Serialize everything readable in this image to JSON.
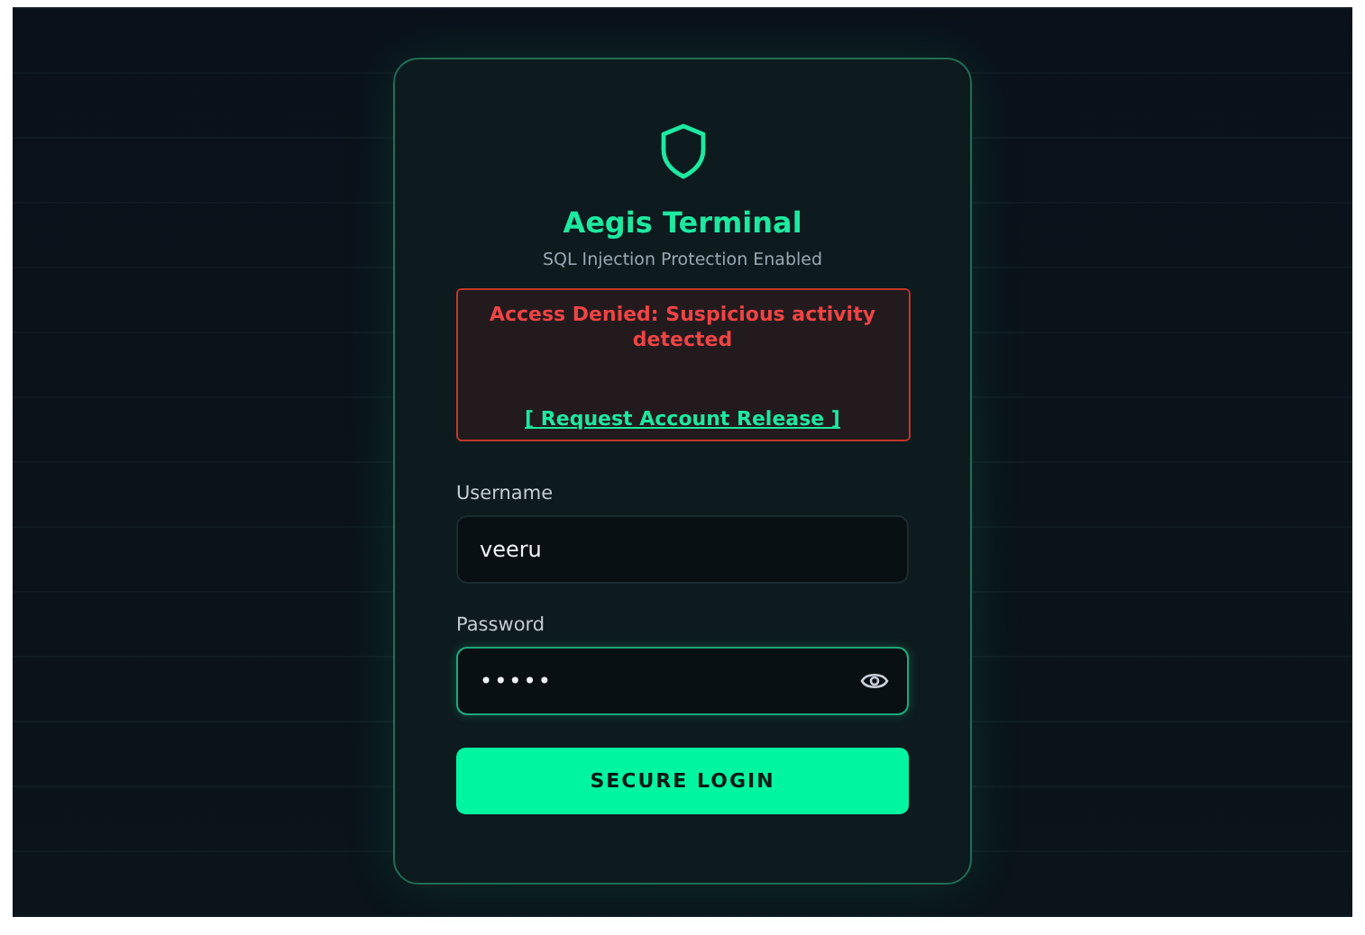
{
  "brand": {
    "title": "Aegis Terminal",
    "subtitle": "SQL Injection Protection Enabled"
  },
  "alert": {
    "message": "Access Denied: Suspicious activity detected",
    "link": "[ Request Account Release ]"
  },
  "fields": [
    {
      "kind": "text",
      "label": "Username",
      "value": "veeru",
      "focused": false
    },
    {
      "kind": "password",
      "label": "Password",
      "value": "•••••",
      "focused": true
    }
  ],
  "submit": {
    "label": "SECURE LOGIN"
  }
}
